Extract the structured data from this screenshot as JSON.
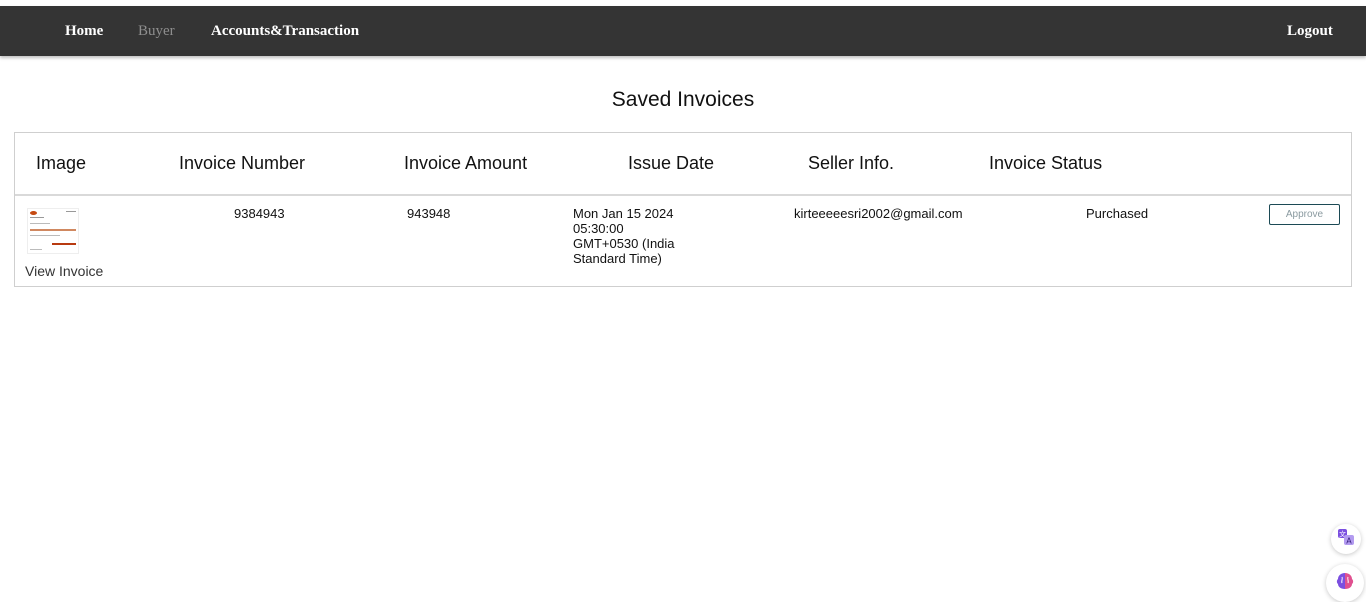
{
  "nav": {
    "home": "Home",
    "buyer": "Buyer",
    "accounts": "Accounts&Transaction",
    "logout": "Logout"
  },
  "page": {
    "title": "Saved Invoices"
  },
  "table": {
    "headers": {
      "image": "Image",
      "invoice_number": "Invoice Number",
      "invoice_amount": "Invoice Amount",
      "issue_date": "Issue Date",
      "seller_info": "Seller Info.",
      "invoice_status": "Invoice Status"
    },
    "rows": [
      {
        "view_link": "View Invoice",
        "invoice_number": "9384943",
        "invoice_amount": "943948",
        "issue_date_lines": [
          "Mon Jan 15 2024",
          "05:30:00",
          "GMT+0530 (India",
          "Standard Time)"
        ],
        "seller_info": "kirteeeeesri2002@gmail.com",
        "invoice_status": "Purchased",
        "action": "Approve"
      }
    ]
  },
  "floating": {
    "translate_icon": "translate-icon",
    "brain_icon": "brain-icon"
  },
  "colors": {
    "navbar": "#343434",
    "nav_muted": "#8e8e8e",
    "approve_border": "#1c4a55",
    "icon_accent": "#7b4fe0"
  }
}
